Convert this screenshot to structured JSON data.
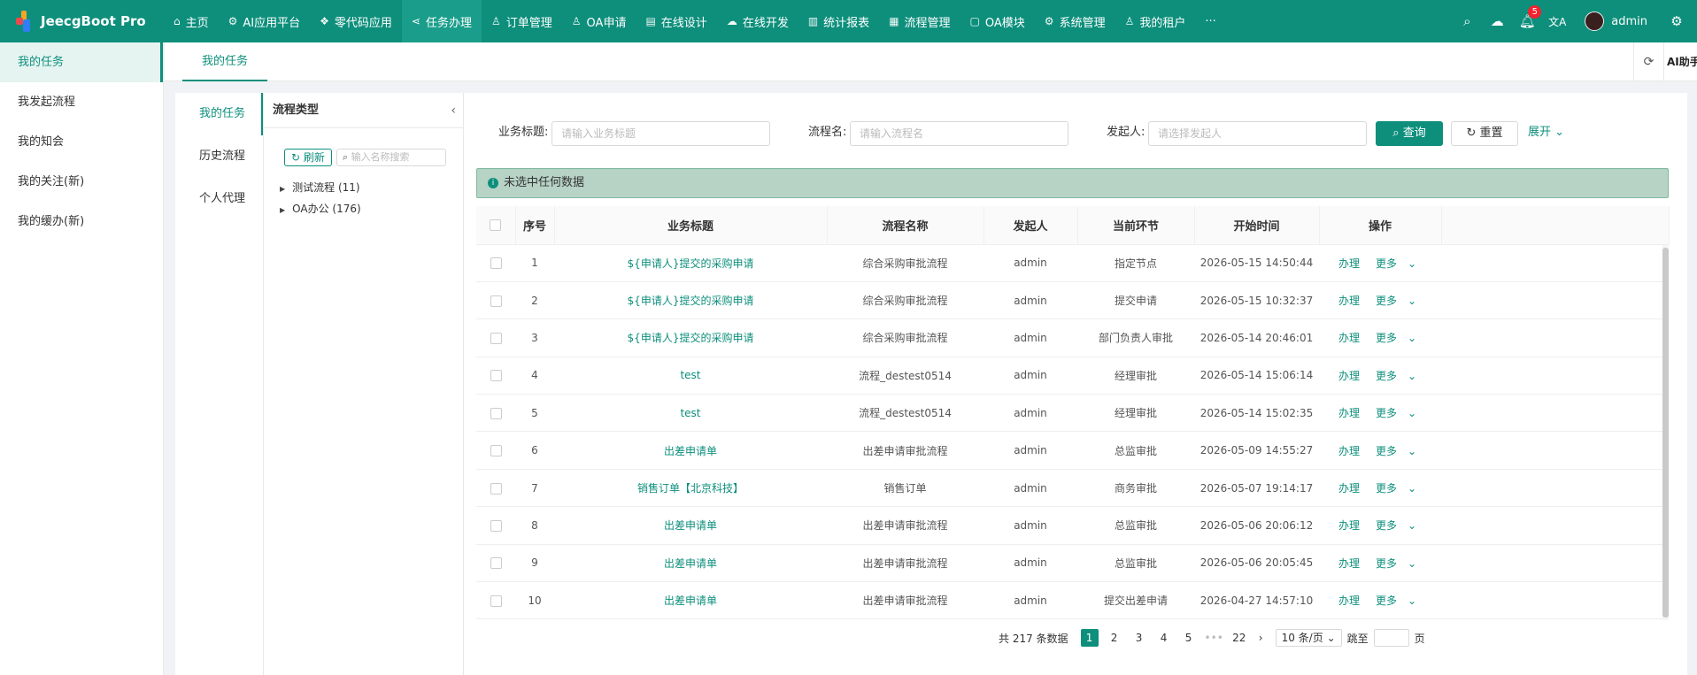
{
  "app": {
    "title": "JeecgBoot Pro"
  },
  "nav": [
    {
      "label": "主页",
      "icon": "home-icon",
      "glyph": "⌂"
    },
    {
      "label": "AI应用平台",
      "icon": "ai-icon",
      "glyph": "⚙"
    },
    {
      "label": "零代码应用",
      "icon": "cube-icon",
      "glyph": "❖"
    },
    {
      "label": "任务办理",
      "icon": "share-icon",
      "glyph": "⋖"
    },
    {
      "label": "订单管理",
      "icon": "user-icon",
      "glyph": "♙"
    },
    {
      "label": "OA申请",
      "icon": "user-icon",
      "glyph": "♙"
    },
    {
      "label": "在线设计",
      "icon": "building-icon",
      "glyph": "▤"
    },
    {
      "label": "在线开发",
      "icon": "cloud-icon",
      "glyph": "☁"
    },
    {
      "label": "统计报表",
      "icon": "chart-icon",
      "glyph": "▥"
    },
    {
      "label": "流程管理",
      "icon": "flow-icon",
      "glyph": "▦"
    },
    {
      "label": "OA模块",
      "icon": "doc-icon",
      "glyph": "▢"
    },
    {
      "label": "系统管理",
      "icon": "gear-icon",
      "glyph": "⚙"
    },
    {
      "label": "我的租户",
      "icon": "user-icon",
      "glyph": "♙"
    },
    {
      "label": "···",
      "icon": "more-icon",
      "glyph": ""
    }
  ],
  "nav_active": 3,
  "topbar": {
    "notify_count": "5",
    "username": "admin"
  },
  "sidebar": {
    "items": [
      "我的任务",
      "我发起流程",
      "我的知会",
      "我的关注(新)",
      "我的缓办(新)"
    ]
  },
  "tabs": {
    "active": "我的任务",
    "ai": "AI助手"
  },
  "subnav": {
    "items": [
      "我的任务",
      "历史流程",
      "个人代理"
    ]
  },
  "tree": {
    "title": "流程类型",
    "refresh": "刷新",
    "search_placeholder": "输入名称搜索",
    "nodes": [
      "测试流程 (11)",
      "OA办公 (176)"
    ]
  },
  "filters": {
    "biz_label": "业务标题:",
    "biz_placeholder": "请输入业务标题",
    "proc_label": "流程名:",
    "proc_placeholder": "请输入流程名",
    "starter_label": "发起人:",
    "starter_placeholder": "请选择发起人",
    "query": "查询",
    "reset": "重置",
    "expand": "展开"
  },
  "alert": "未选中任何数据",
  "table": {
    "columns": [
      "序号",
      "业务标题",
      "流程名称",
      "发起人",
      "当前环节",
      "开始时间",
      "操作"
    ],
    "action_do": "办理",
    "action_more": "更多",
    "rows": [
      [
        "1",
        "${申请人}提交的采购申请",
        "综合采购审批流程",
        "admin",
        "指定节点",
        "2026-05-15 14:50:44"
      ],
      [
        "2",
        "${申请人}提交的采购申请",
        "综合采购审批流程",
        "admin",
        "提交申请",
        "2026-05-15 10:32:37"
      ],
      [
        "3",
        "${申请人}提交的采购申请",
        "综合采购审批流程",
        "admin",
        "部门负责人审批",
        "2026-05-14 20:46:01"
      ],
      [
        "4",
        "test",
        "流程_destest0514",
        "admin",
        "经理审批",
        "2026-05-14 15:06:14"
      ],
      [
        "5",
        "test",
        "流程_destest0514",
        "admin",
        "经理审批",
        "2026-05-14 15:02:35"
      ],
      [
        "6",
        "出差申请单",
        "出差申请审批流程",
        "admin",
        "总监审批",
        "2026-05-09 14:55:27"
      ],
      [
        "7",
        "销售订单【北京科技】",
        "销售订单",
        "admin",
        "商务审批",
        "2026-05-07 19:14:17"
      ],
      [
        "8",
        "出差申请单",
        "出差申请审批流程",
        "admin",
        "总监审批",
        "2026-05-06 20:06:12"
      ],
      [
        "9",
        "出差申请单",
        "出差申请审批流程",
        "admin",
        "总监审批",
        "2026-05-06 20:05:45"
      ],
      [
        "10",
        "出差申请单",
        "出差申请审批流程",
        "admin",
        "提交出差申请",
        "2026-04-27 14:57:10"
      ]
    ]
  },
  "pager": {
    "total": "共 217 条数据",
    "pages": [
      "1",
      "2",
      "3",
      "4",
      "5",
      "•••",
      "22"
    ],
    "size": "10 条/页",
    "jump": "跳至",
    "page_unit": "页"
  },
  "colors": {
    "primary": "#0d8f7c"
  }
}
